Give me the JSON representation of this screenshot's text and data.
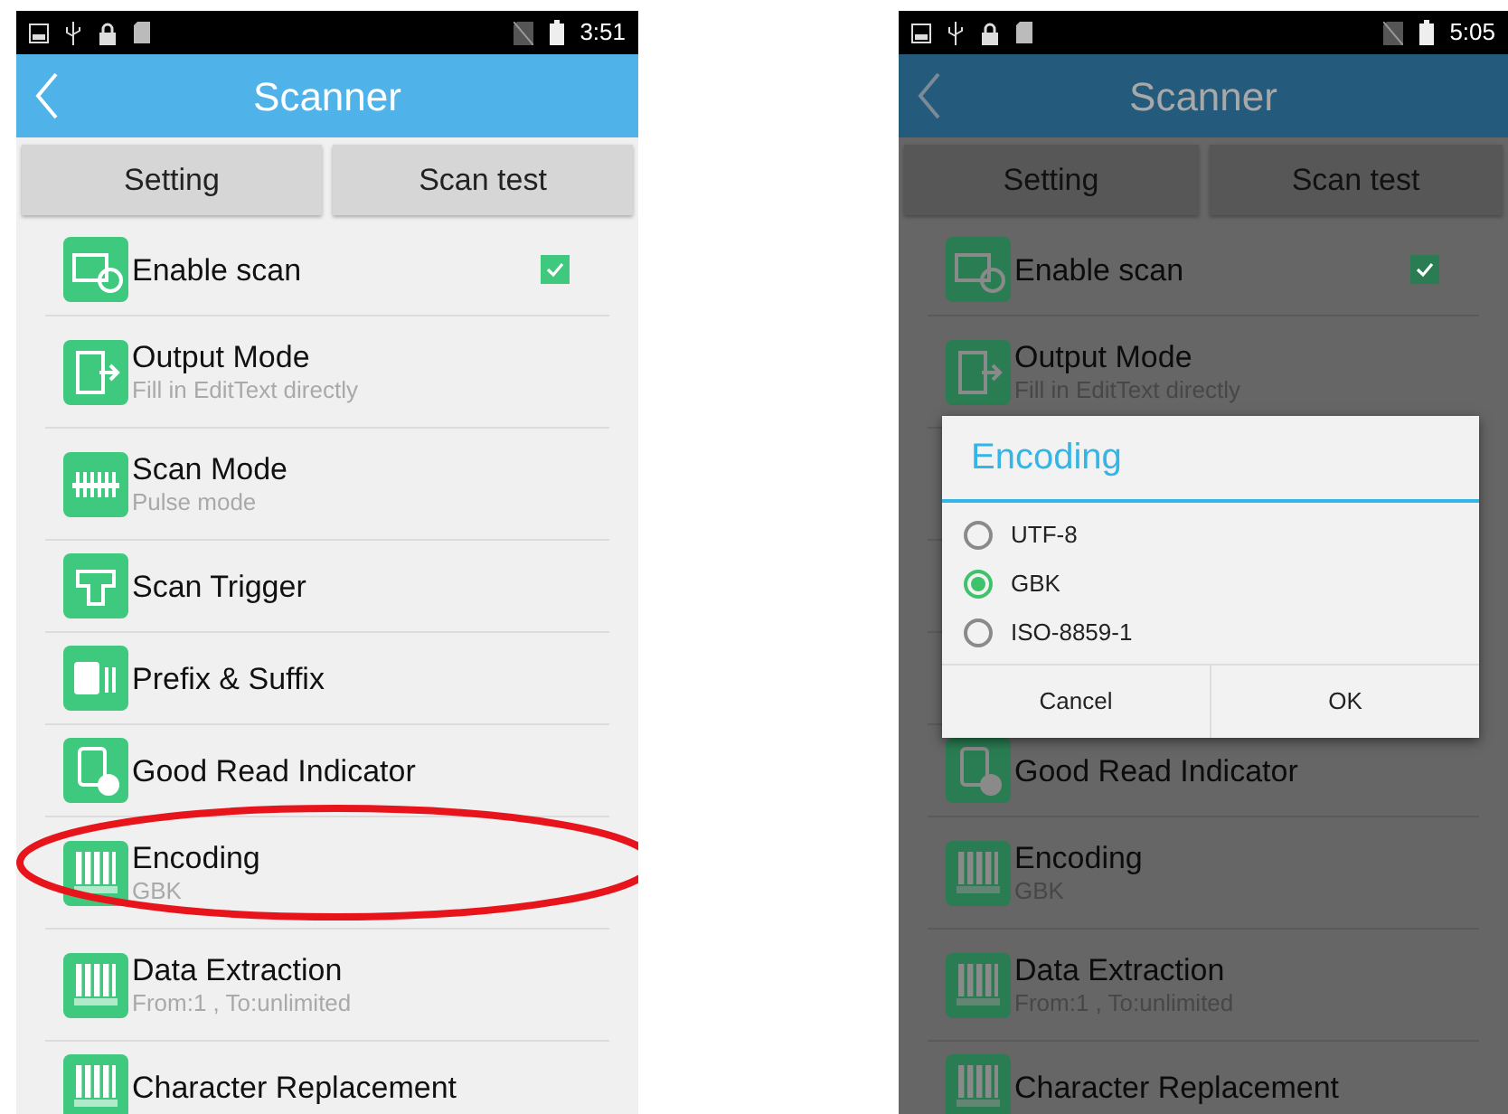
{
  "phones": [
    {
      "dimmed": false,
      "status_bar": {
        "time": "3:51"
      },
      "header": {
        "title": "Scanner"
      },
      "tabs": [
        {
          "label": "Setting"
        },
        {
          "label": "Scan test"
        }
      ],
      "items": [
        {
          "kind": "check",
          "title": "Enable scan",
          "checked": true,
          "highlighted": false
        },
        {
          "kind": "detail",
          "title": "Output Mode",
          "subtitle": "Fill in EditText directly",
          "highlighted": false
        },
        {
          "kind": "detail",
          "title": "Scan Mode",
          "subtitle": "Pulse mode",
          "highlighted": false
        },
        {
          "kind": "plain",
          "title": "Scan Trigger",
          "highlighted": false
        },
        {
          "kind": "plain",
          "title": "Prefix & Suffix",
          "highlighted": false
        },
        {
          "kind": "plain",
          "title": "Good Read Indicator",
          "highlighted": false
        },
        {
          "kind": "detail",
          "title": "Encoding",
          "subtitle": "GBK",
          "highlighted": true
        },
        {
          "kind": "detail",
          "title": "Data Extraction",
          "subtitle": "From:1 , To:unlimited",
          "highlighted": false
        },
        {
          "kind": "plain",
          "title": "Character Replacement",
          "highlighted": false
        }
      ]
    },
    {
      "dimmed": true,
      "status_bar": {
        "time": "5:05"
      },
      "header": {
        "title": "Scanner"
      },
      "tabs": [
        {
          "label": "Setting"
        },
        {
          "label": "Scan test"
        }
      ],
      "items": [
        {
          "kind": "check",
          "title": "Enable scan",
          "checked": true,
          "highlighted": false
        },
        {
          "kind": "detail",
          "title": "Output Mode",
          "subtitle": "Fill in EditText directly",
          "highlighted": false
        },
        {
          "kind": "covered_tall"
        },
        {
          "kind": "covered"
        },
        {
          "kind": "covered"
        },
        {
          "kind": "plain",
          "title": "Good Read Indicator",
          "highlighted": false
        },
        {
          "kind": "detail",
          "title": "Encoding",
          "subtitle": "GBK",
          "highlighted": false
        },
        {
          "kind": "detail",
          "title": "Data Extraction",
          "subtitle": "From:1 , To:unlimited",
          "highlighted": false
        },
        {
          "kind": "plain",
          "title": "Character Replacement",
          "highlighted": false
        }
      ],
      "dialog": {
        "title": "Encoding",
        "options": [
          {
            "label": "UTF-8",
            "selected": false
          },
          {
            "label": "GBK",
            "selected": true
          },
          {
            "label": "ISO-8859-1",
            "selected": false
          }
        ],
        "buttons": [
          "Cancel",
          "OK"
        ]
      }
    }
  ]
}
